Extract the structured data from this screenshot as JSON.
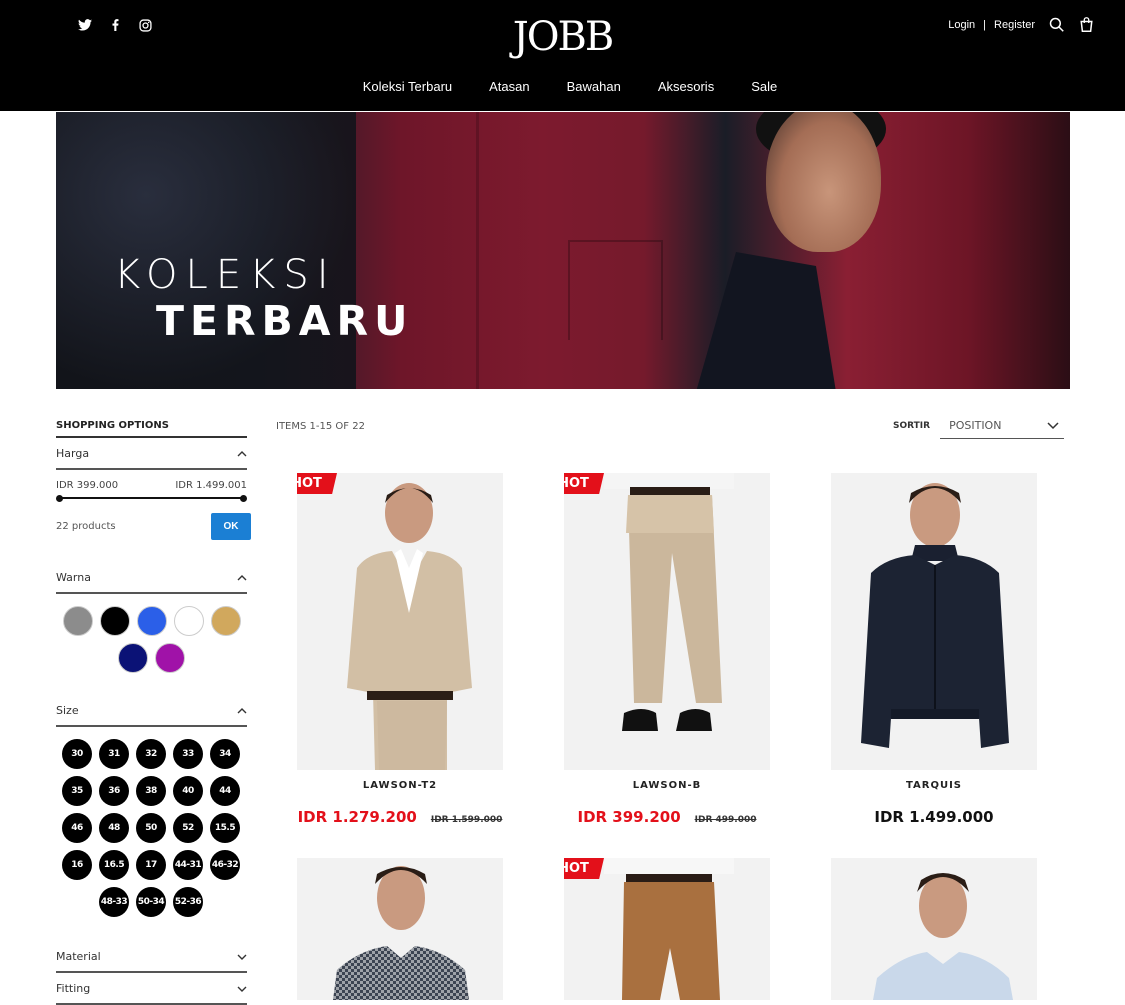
{
  "brand": {
    "logo": "JOBB"
  },
  "account": {
    "login": "Login",
    "separator": "|",
    "register": "Register"
  },
  "nav": [
    {
      "label": "Koleksi Terbaru"
    },
    {
      "label": "Atasan"
    },
    {
      "label": "Bawahan"
    },
    {
      "label": "Aksesoris"
    },
    {
      "label": "Sale"
    }
  ],
  "hero": {
    "line1": "KOLEKSI",
    "line2": "TERBARU"
  },
  "sidebar": {
    "title": "SHOPPING OPTIONS",
    "price": {
      "label": "Harga",
      "min": "IDR 399.000",
      "max": "IDR 1.499.001",
      "count": "22 products",
      "ok": "OK"
    },
    "color": {
      "label": "Warna",
      "swatches": [
        "#8c8c8c",
        "#000000",
        "#2b5fe8",
        "#ffffff",
        "#d1a85d",
        "#0b1276",
        "#a012a8"
      ]
    },
    "size": {
      "label": "Size",
      "options": [
        "30",
        "31",
        "32",
        "33",
        "34",
        "35",
        "36",
        "38",
        "40",
        "44",
        "46",
        "48",
        "50",
        "52",
        "15.5",
        "16",
        "16.5",
        "17",
        "44-31",
        "46-32",
        "48-33",
        "50-34",
        "52-36"
      ]
    },
    "material": {
      "label": "Material"
    },
    "fitting": {
      "label": "Fitting"
    }
  },
  "toolbar": {
    "items": "ITEMS 1-15 OF 22",
    "sort_label": "SORTIR",
    "sort_value": "POSITION"
  },
  "products": [
    {
      "hot": "HOT",
      "name": "LAWSON-T2",
      "price": "IDR 1.279.200",
      "old": "IDR 1.599.000"
    },
    {
      "hot": "HOT",
      "name": "LAWSON-B",
      "price": "IDR 399.200",
      "old": "IDR 499.000"
    },
    {
      "hot": "",
      "name": "TARQUIS",
      "price": "IDR 1.499.000",
      "old": ""
    },
    {
      "hot": ""
    },
    {
      "hot": "HOT"
    },
    {
      "hot": ""
    }
  ],
  "colors": {
    "header_bg": "#000000",
    "accent_red": "#e3101a",
    "ok_blue": "#1b7fd4"
  }
}
